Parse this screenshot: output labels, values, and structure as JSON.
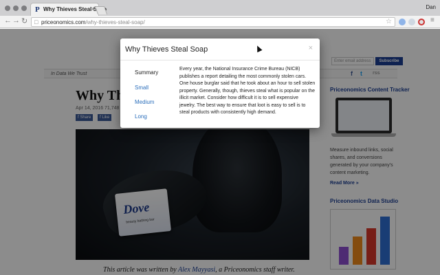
{
  "browser": {
    "tab_favicon": "P",
    "tab_title": "Why Thieves Steal Soap",
    "tab_close": "×",
    "user": "Dan",
    "url_host": "priceonomics.com",
    "url_path": "/why-thieves-steal-soap/",
    "back_icon": "arrow-left-icon",
    "forward_icon": "arrow-right-icon",
    "reload_icon": "reload-icon"
  },
  "page": {
    "email_placeholder": "Enter email address",
    "subscribe_label": "Subscribe",
    "tagline": "In Data We Trust",
    "social": [
      "f",
      "t",
      "rss"
    ],
    "article_title": "Why Thi",
    "meta": "Apr 14, 2016   71,748",
    "share_labels": [
      "f Share",
      "f Like"
    ],
    "soap_brand": "Dove",
    "soap_sub": "beauty bathing bar",
    "caption_prefix": "This article was written by ",
    "caption_author": "Alex Mayyasi",
    "caption_suffix": ", a Priceonomics staff writer.",
    "sidebar": {
      "tracker_heading": "Priceonomics Content Tracker",
      "tracker_text": "Measure inbound links, social shares, and conversions generated by your company's content marketing.",
      "read_more": "Read More »",
      "studio_heading": "Priceonomics Data Studio",
      "studio_bars": [
        {
          "value": 0.35,
          "color": "#8e4fd1"
        },
        {
          "value": 0.55,
          "color": "#f08a1c"
        },
        {
          "value": 0.72,
          "color": "#d9382a"
        },
        {
          "value": 0.95,
          "color": "#2f6fd6"
        }
      ]
    }
  },
  "modal": {
    "title": "Why Thieves Steal Soap",
    "close": "×",
    "modes": [
      "Summary",
      "Small",
      "Medium",
      "Long"
    ],
    "active_mode": "Summary",
    "summary_text": "Every year, the National Insurance Crime Bureau (NICB) publishes a report detailing the most commonly stolen cars. One house burglar said that he took about an hour to sell stolen property. Generally, though, thieves steal what is popular on the illicit market. Consider how difficult it is to sell expensive jewelry. The best way to ensure that loot is easy to sell is to steal products with consistently high demand."
  },
  "colors": {
    "brand_blue": "#1c3f94",
    "link_blue": "#2a6ebb"
  }
}
